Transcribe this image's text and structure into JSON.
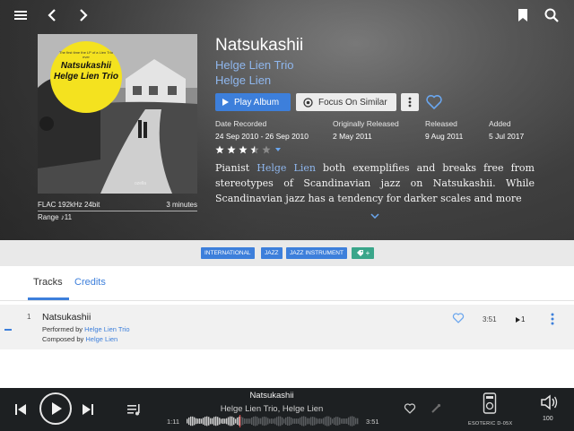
{
  "album": {
    "title": "Natsukashii",
    "artists": [
      "Helge Lien Trio",
      "Helge Lien"
    ],
    "cover": {
      "badge_small_top": "The first time the LP of a Lien Trio ever",
      "badge_title_1": "Natsukashii",
      "badge_title_2": "Helge Lien Trio",
      "mark": "ozella"
    },
    "format": "FLAC 192kHz 24bit",
    "duration": "3 minutes",
    "range": "Range ♪11",
    "actions": {
      "play_label": "Play Album",
      "focus_label": "Focus On Similar"
    },
    "meta": [
      {
        "label": "Date Recorded",
        "value": "24 Sep 2010 - 26 Sep 2010"
      },
      {
        "label": "Originally Released",
        "value": "2 May 2011"
      },
      {
        "label": "Released",
        "value": "9 Aug 2011"
      },
      {
        "label": "Added",
        "value": "5 Jul 2017"
      }
    ],
    "rating": 3.5,
    "rating_max": 5,
    "review": {
      "before": "Pianist ",
      "link": "Helge Lien",
      "after": " both exemplifies and breaks free from stereotypes of Scandinavian jazz on Natsukashii. While Scandinavian jazz has a tendency for darker scales and more"
    }
  },
  "tags": [
    "INTERNATIONAL",
    "JAZZ",
    "JAZZ INSTRUMENT"
  ],
  "tabs": [
    "Tracks",
    "Credits"
  ],
  "tracks": [
    {
      "number": "1",
      "title": "Natsukashii",
      "performed_label": "Performed by ",
      "performed_by": "Helge Lien Trio",
      "composed_label": "Composed by ",
      "composed_by": "Helge Lien",
      "duration": "3:51",
      "play_next": "1"
    }
  ],
  "player": {
    "title": "Natsukashii",
    "artist": "Helge Lien Trio, Helge Lien",
    "elapsed": "1:11",
    "total": "3:51",
    "progress": 0.307,
    "device": "ESOTERIC D-05X",
    "volume": "100"
  },
  "colors": {
    "accent": "#3d7fdb",
    "link": "#8fb7ee",
    "tag_add": "#3aa68a",
    "player_bg": "#1d2022"
  }
}
